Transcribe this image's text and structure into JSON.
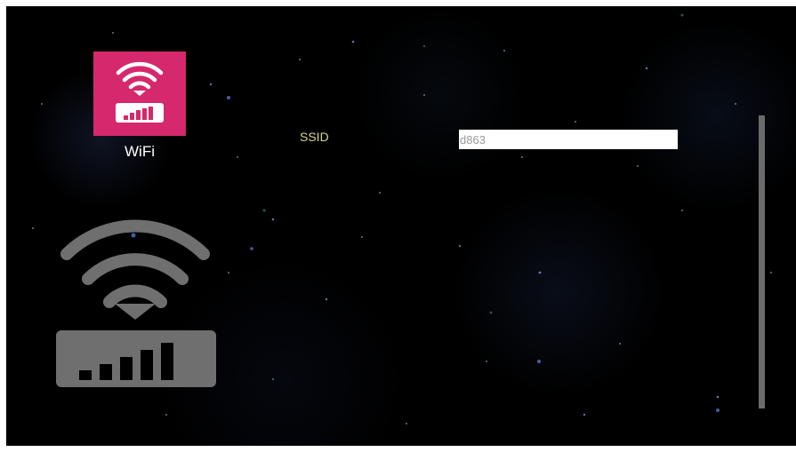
{
  "menu": {
    "tile_label": "WiFi",
    "tile_icon": "wifi-signal-icon",
    "tile_color": "#d6286c"
  },
  "preview": {
    "icon": "wifi-signal-large-icon"
  },
  "form": {
    "ssid_label": "SSID",
    "ssid_value": "d863"
  },
  "colors": {
    "label": "#d9d48a",
    "background": "#000000",
    "scrollbar": "#6b6b6b"
  }
}
